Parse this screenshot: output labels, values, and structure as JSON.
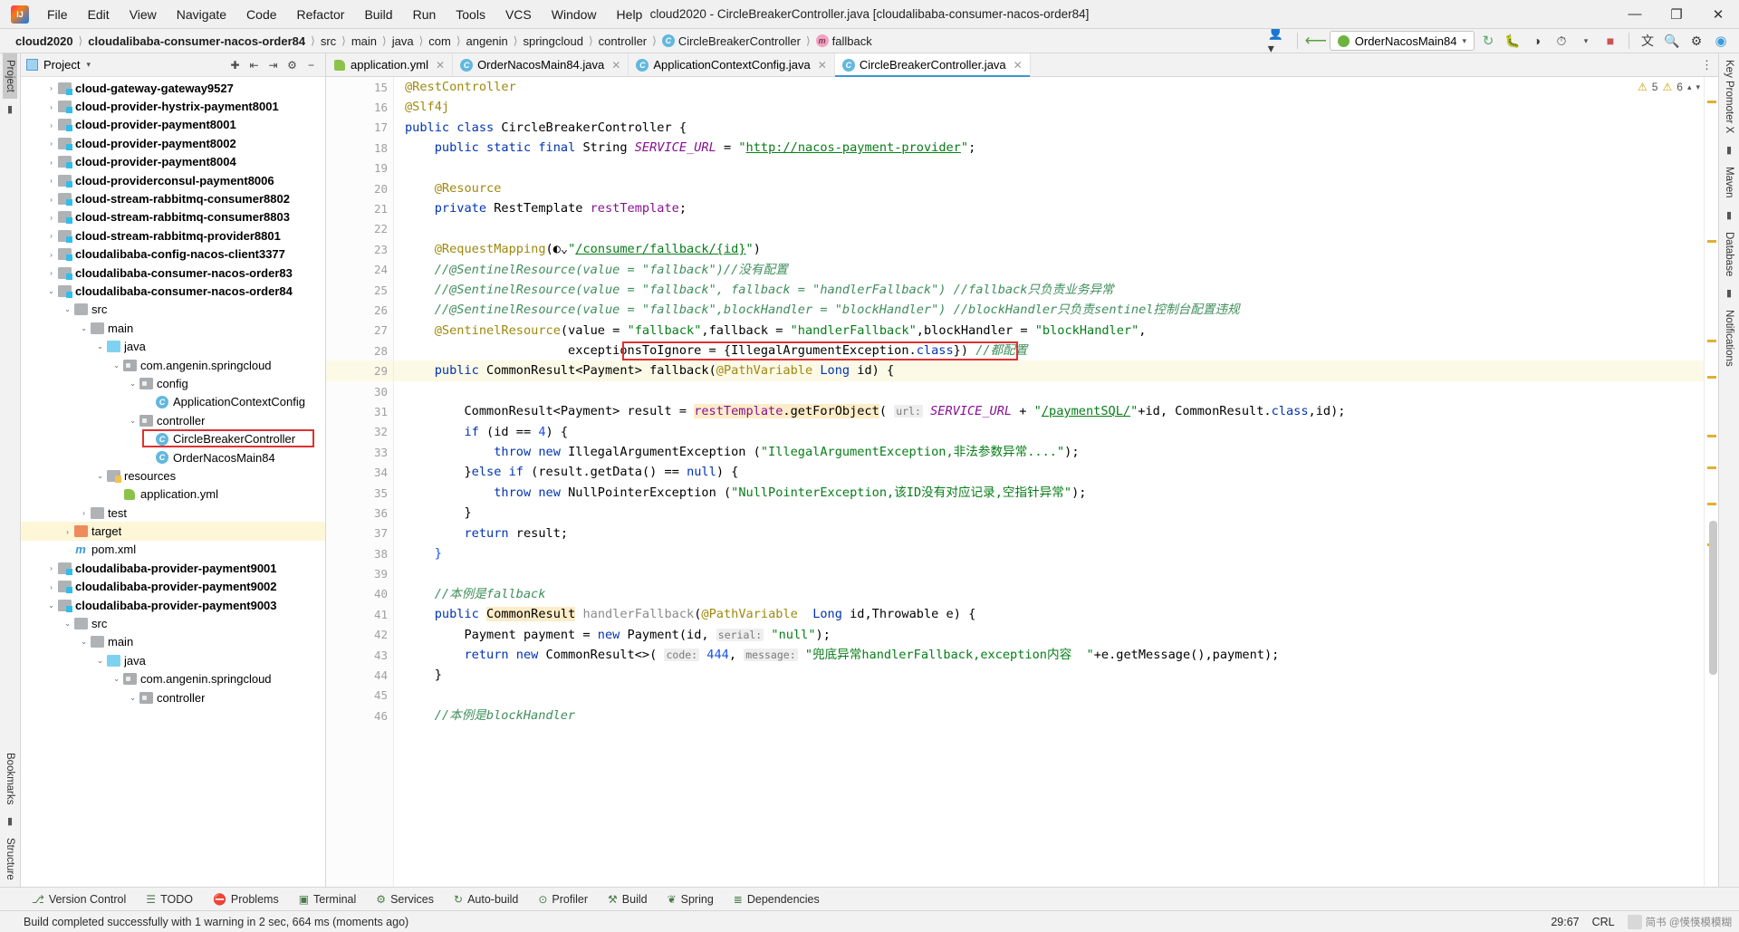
{
  "window": {
    "title": "cloud2020 - CircleBreakerController.java [cloudalibaba-consumer-nacos-order84]",
    "minimize": "—",
    "maximize": "❐",
    "close": "✕"
  },
  "menu": [
    "File",
    "Edit",
    "View",
    "Navigate",
    "Code",
    "Refactor",
    "Build",
    "Run",
    "Tools",
    "VCS",
    "Window",
    "Help"
  ],
  "breadcrumb": [
    {
      "label": "cloud2020",
      "bold": true,
      "icon": ""
    },
    {
      "label": "cloudalibaba-consumer-nacos-order84",
      "bold": true,
      "icon": ""
    },
    {
      "label": "src",
      "bold": false,
      "icon": ""
    },
    {
      "label": "main",
      "bold": false,
      "icon": ""
    },
    {
      "label": "java",
      "bold": false,
      "icon": ""
    },
    {
      "label": "com",
      "bold": false,
      "icon": ""
    },
    {
      "label": "angenin",
      "bold": false,
      "icon": ""
    },
    {
      "label": "springcloud",
      "bold": false,
      "icon": ""
    },
    {
      "label": "controller",
      "bold": false,
      "icon": ""
    },
    {
      "label": "CircleBreakerController",
      "bold": false,
      "icon": "class-icon"
    },
    {
      "label": "fallback",
      "bold": false,
      "icon": "method-icon"
    }
  ],
  "toolbar": {
    "run_config": "OrderNacosMain84",
    "icons": [
      "user-dropdown-icon",
      "hammer-build-icon",
      "rerun-icon",
      "debug-icon",
      "coverage-icon",
      "profile-icon",
      "stop-icon",
      "translate-icon",
      "search-icon",
      "gear-icon",
      "updates-icon"
    ]
  },
  "project_panel": {
    "title": "Project",
    "actions": [
      "locate-icon",
      "expand-all-icon",
      "collapse-all-icon",
      "settings-icon",
      "hide-icon"
    ],
    "tree": [
      {
        "depth": 1,
        "arrow": "›",
        "icon": "f-mod",
        "label": "cloud-gateway-gateway9527",
        "bold": true
      },
      {
        "depth": 1,
        "arrow": "›",
        "icon": "f-mod",
        "label": "cloud-provider-hystrix-payment8001",
        "bold": true
      },
      {
        "depth": 1,
        "arrow": "›",
        "icon": "f-mod",
        "label": "cloud-provider-payment8001",
        "bold": true
      },
      {
        "depth": 1,
        "arrow": "›",
        "icon": "f-mod",
        "label": "cloud-provider-payment8002",
        "bold": true
      },
      {
        "depth": 1,
        "arrow": "›",
        "icon": "f-mod",
        "label": "cloud-provider-payment8004",
        "bold": true
      },
      {
        "depth": 1,
        "arrow": "›",
        "icon": "f-mod",
        "label": "cloud-providerconsul-payment8006",
        "bold": true
      },
      {
        "depth": 1,
        "arrow": "›",
        "icon": "f-mod",
        "label": "cloud-stream-rabbitmq-consumer8802",
        "bold": true
      },
      {
        "depth": 1,
        "arrow": "›",
        "icon": "f-mod",
        "label": "cloud-stream-rabbitmq-consumer8803",
        "bold": true
      },
      {
        "depth": 1,
        "arrow": "›",
        "icon": "f-mod",
        "label": "cloud-stream-rabbitmq-provider8801",
        "bold": true
      },
      {
        "depth": 1,
        "arrow": "›",
        "icon": "f-mod",
        "label": "cloudalibaba-config-nacos-client3377",
        "bold": true
      },
      {
        "depth": 1,
        "arrow": "›",
        "icon": "f-mod",
        "label": "cloudalibaba-consumer-nacos-order83",
        "bold": true
      },
      {
        "depth": 1,
        "arrow": "⌄",
        "icon": "f-mod",
        "label": "cloudalibaba-consumer-nacos-order84",
        "bold": true
      },
      {
        "depth": 2,
        "arrow": "⌄",
        "icon": "f-plain",
        "label": "src",
        "bold": false
      },
      {
        "depth": 3,
        "arrow": "⌄",
        "icon": "f-plain",
        "label": "main",
        "bold": false
      },
      {
        "depth": 4,
        "arrow": "⌄",
        "icon": "f-src",
        "label": "java",
        "bold": false
      },
      {
        "depth": 5,
        "arrow": "⌄",
        "icon": "f-pkg",
        "label": "com.angenin.springcloud",
        "bold": false
      },
      {
        "depth": 6,
        "arrow": "⌄",
        "icon": "f-pkg",
        "label": "config",
        "bold": false
      },
      {
        "depth": 7,
        "arrow": "",
        "icon": "cls",
        "label": "ApplicationContextConfig",
        "bold": false
      },
      {
        "depth": 6,
        "arrow": "⌄",
        "icon": "f-pkg",
        "label": "controller",
        "bold": false
      },
      {
        "depth": 7,
        "arrow": "",
        "icon": "cls",
        "label": "CircleBreakerController",
        "bold": false,
        "boxed": true
      },
      {
        "depth": 7,
        "arrow": "",
        "icon": "cls-spring",
        "label": "OrderNacosMain84",
        "bold": false
      },
      {
        "depth": 4,
        "arrow": "⌄",
        "icon": "f-res",
        "label": "resources",
        "bold": false
      },
      {
        "depth": 5,
        "arrow": "",
        "icon": "yml",
        "label": "application.yml",
        "bold": false
      },
      {
        "depth": 3,
        "arrow": "›",
        "icon": "f-plain",
        "label": "test",
        "bold": false
      },
      {
        "depth": 2,
        "arrow": "›",
        "icon": "f-target",
        "label": "target",
        "bold": false,
        "hl": true
      },
      {
        "depth": 2,
        "arrow": "",
        "icon": "m",
        "label": "pom.xml",
        "bold": false
      },
      {
        "depth": 1,
        "arrow": "›",
        "icon": "f-mod",
        "label": "cloudalibaba-provider-payment9001",
        "bold": true
      },
      {
        "depth": 1,
        "arrow": "›",
        "icon": "f-mod",
        "label": "cloudalibaba-provider-payment9002",
        "bold": true
      },
      {
        "depth": 1,
        "arrow": "⌄",
        "icon": "f-mod",
        "label": "cloudalibaba-provider-payment9003",
        "bold": true
      },
      {
        "depth": 2,
        "arrow": "⌄",
        "icon": "f-plain",
        "label": "src",
        "bold": false
      },
      {
        "depth": 3,
        "arrow": "⌄",
        "icon": "f-plain",
        "label": "main",
        "bold": false
      },
      {
        "depth": 4,
        "arrow": "⌄",
        "icon": "f-src",
        "label": "java",
        "bold": false
      },
      {
        "depth": 5,
        "arrow": "⌄",
        "icon": "f-pkg",
        "label": "com.angenin.springcloud",
        "bold": false
      },
      {
        "depth": 6,
        "arrow": "⌄",
        "icon": "f-pkg",
        "label": "controller",
        "bold": false
      }
    ]
  },
  "left_rail": [
    "Project",
    "Structure",
    "Bookmarks"
  ],
  "right_rail": [
    "Key Promoter X",
    "Maven",
    "Database",
    "Notifications"
  ],
  "editor": {
    "tabs": [
      {
        "label": "application.yml",
        "icon": "yml-icon",
        "active": false,
        "closable": true
      },
      {
        "label": "OrderNacosMain84.java",
        "icon": "spring-class-icon",
        "active": false,
        "closable": true
      },
      {
        "label": "ApplicationContextConfig.java",
        "icon": "class-icon",
        "active": false,
        "closable": true
      },
      {
        "label": "CircleBreakerController.java",
        "icon": "class-icon",
        "active": true,
        "closable": true
      }
    ],
    "inspections": {
      "warnings": "5",
      "weak_warnings": "6"
    },
    "first_line": 15,
    "lines": [
      {
        "n": 15,
        "html": "<span class=\"an\">@RestController</span>"
      },
      {
        "n": 16,
        "html": "<span class=\"an\">@Slf4j</span>"
      },
      {
        "n": 17,
        "html": "<span class=\"k\">public</span> <span class=\"k\">class</span> CircleBreakerController {"
      },
      {
        "n": 18,
        "html": "    <span class=\"k\">public</span> <span class=\"k\">static</span> <span class=\"k\">final</span> String <span class=\"st\">SERVICE_URL</span> = <span class=\"s\">\"</span><span class=\"lnk\">http://nacos-payment-provider</span><span class=\"s\">\"</span>;"
      },
      {
        "n": 19,
        "html": ""
      },
      {
        "n": 20,
        "html": "    <span class=\"an\">@Resource</span>"
      },
      {
        "n": 21,
        "html": "    <span class=\"k\">private</span> RestTemplate <span class=\"fld\">restTemplate</span>;"
      },
      {
        "n": 22,
        "html": ""
      },
      {
        "n": 23,
        "html": "    <span class=\"an\">@RequestMapping</span>(<span class=\"globe\">◐⌄</span><span class=\"s\">\"</span><span class=\"lnk\">/consumer/fallback/{id}</span><span class=\"s\">\"</span>)"
      },
      {
        "n": 24,
        "html": "    <span class=\"cm\">//@SentinelResource(value = \"fallback\")//没有配置</span>"
      },
      {
        "n": 25,
        "html": "    <span class=\"cm\">//@SentinelResource(value = \"fallback\", fallback = \"handlerFallback\") //fallback只负责业务异常</span>"
      },
      {
        "n": 26,
        "html": "    <span class=\"cm\">//@SentinelResource(value = \"fallback\",blockHandler = \"blockHandler\") //blockHandler只负责sentinel控制台配置违规</span>"
      },
      {
        "n": 27,
        "html": "    <span class=\"an\">@SentinelResource</span>(value = <span class=\"s\">\"fallback\"</span>,fallback = <span class=\"s\">\"handlerFallback\"</span>,blockHandler = <span class=\"s\">\"blockHandler\"</span>,"
      },
      {
        "n": 28,
        "html": "                      exceptionsToIgnore = {IllegalArgumentException.<span class=\"k\">class</span>}) <span class=\"cm\">//都配置</span>"
      },
      {
        "n": 29,
        "html": "    <span class=\"k\">public</span> CommonResult&lt;Payment&gt; fallback(<span class=\"an\">@PathVariable</span> <span class=\"k\">Long</span> id) {",
        "cur": true
      },
      {
        "n": 30,
        "html": ""
      },
      {
        "n": 31,
        "html": "        CommonResult&lt;Payment&gt; result = <span class=\"hl2\"><span class=\"fld\">restTemplate</span>.<span class=\"meth\">getForObject</span></span>( <span class=\"param\">url:</span> <span class=\"st\">SERVICE_URL</span> + <span class=\"s\">\"</span><span class=\"lnk\">/paymentSQL/</span><span class=\"s\">\"</span>+id, CommonResult.<span class=\"k\">class</span>,id);"
      },
      {
        "n": 32,
        "html": "        <span class=\"k\">if</span> (id == <span class=\"num\">4</span>) {"
      },
      {
        "n": 33,
        "html": "            <span class=\"k\">throw</span> <span class=\"k\">new</span> IllegalArgumentException (<span class=\"s\">\"IllegalArgumentException,非法参数异常....\"</span>);"
      },
      {
        "n": 34,
        "html": "        }<span class=\"k\">else</span> <span class=\"k\">if</span> (result.<span class=\"meth\">getData</span>() == <span class=\"k\">null</span>) {"
      },
      {
        "n": 35,
        "html": "            <span class=\"k\">throw</span> <span class=\"k\">new</span> NullPointerException (<span class=\"s\">\"NullPointerException,该ID没有对应记录,空指针异常\"</span>);"
      },
      {
        "n": 36,
        "html": "        }"
      },
      {
        "n": 37,
        "html": "        <span class=\"k\">return</span> result;"
      },
      {
        "n": 38,
        "html": "    <span class=\"num\">}</span>"
      },
      {
        "n": 39,
        "html": ""
      },
      {
        "n": 40,
        "html": "    <span class=\"cm\">//本例是fallback</span>"
      },
      {
        "n": 41,
        "html": "    <span class=\"k\">public</span> <span class=\"hl2\">CommonResult</span> <span class=\"meth\" style=\"color:#8a8a8a\">handlerFallback</span>(<span class=\"an\">@PathVariable</span>  <span class=\"k\">Long</span> id,Throwable e) {"
      },
      {
        "n": 42,
        "html": "        Payment payment = <span class=\"k\">new</span> Payment(id, <span class=\"param\">serial:</span> <span class=\"s\">\"null\"</span>);"
      },
      {
        "n": 43,
        "html": "        <span class=\"k\">return</span> <span class=\"k\">new</span> CommonResult&lt;&gt;( <span class=\"param\">code:</span> <span class=\"num\">444</span>, <span class=\"param\">message:</span> <span class=\"s\">\"兜底异常handlerFallback,exception内容  \"</span>+e.<span class=\"meth\">getMessage</span>(),payment);"
      },
      {
        "n": 44,
        "html": "    }"
      },
      {
        "n": 45,
        "html": ""
      },
      {
        "n": 46,
        "html": "    <span class=\"cm\">//本例是blockHandler</span>"
      }
    ]
  },
  "bottom_tools": [
    {
      "label": "Version Control",
      "icon": "branch-icon"
    },
    {
      "label": "TODO",
      "icon": "list-icon"
    },
    {
      "label": "Problems",
      "icon": "error-icon"
    },
    {
      "label": "Terminal",
      "icon": "terminal-icon"
    },
    {
      "label": "Services",
      "icon": "services-icon"
    },
    {
      "label": "Auto-build",
      "icon": "refresh-icon"
    },
    {
      "label": "Profiler",
      "icon": "profiler-icon"
    },
    {
      "label": "Build",
      "icon": "hammer-icon"
    },
    {
      "label": "Spring",
      "icon": "spring-leaf-icon"
    },
    {
      "label": "Dependencies",
      "icon": "dependencies-icon"
    }
  ],
  "status": {
    "message": "Build completed successfully with 1 warning in 2 sec, 664 ms (moments ago)",
    "caret": "29:67",
    "encoding": "CRL",
    "watermark": "简书 @愥愥模模糊"
  }
}
